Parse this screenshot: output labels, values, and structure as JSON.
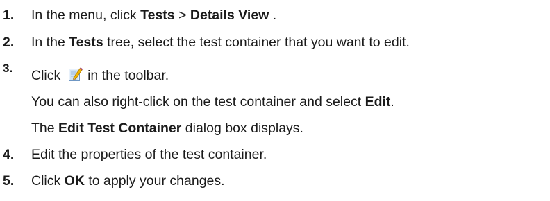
{
  "steps": [
    {
      "number": "1.",
      "pre": "In the menu, click ",
      "bold1": "Tests",
      "mid": " > ",
      "bold2": "Details View",
      "post": " ."
    },
    {
      "number": "2.",
      "pre": "In the ",
      "bold": "Tests",
      "post": " tree, select the test container that you want to edit."
    },
    {
      "number": "3.",
      "pre": "Click ",
      "icon": "edit-icon",
      "post": " in the toolbar.",
      "note1_pre": "You can also right-click on the test container and select ",
      "note1_bold": "Edit",
      "note1_post": ".",
      "note2_pre": "The ",
      "note2_bold": "Edit Test Container",
      "note2_post": " dialog box displays."
    },
    {
      "number": "4.",
      "text": "Edit the properties of the test container."
    },
    {
      "number": "5.",
      "pre": "Click ",
      "bold": "OK",
      "post": " to apply your changes."
    }
  ],
  "colors": {
    "text": "#1a1a1a",
    "icon_page": "#cfe3f7",
    "icon_pencil": "#f2b600"
  }
}
